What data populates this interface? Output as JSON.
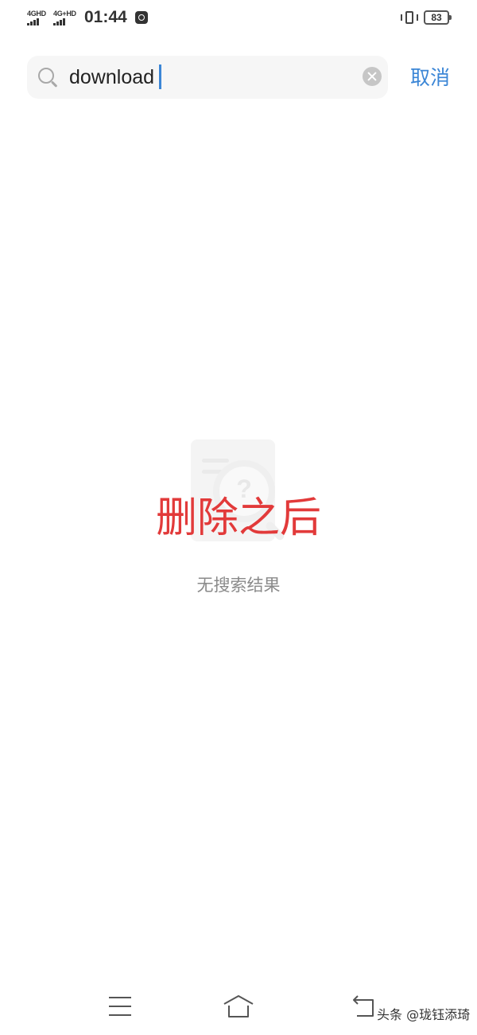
{
  "status_bar": {
    "network_1": "4GHD",
    "network_2": "4G+HD",
    "time": "01:44",
    "battery_level": "83"
  },
  "search": {
    "value": "download",
    "placeholder": "",
    "cancel_label": "取消"
  },
  "annotation": {
    "caption": "删除之后",
    "color": "#e23a3a"
  },
  "empty_state": {
    "message": "无搜索结果",
    "icon": "no-results-illustration"
  },
  "nav_bar": {
    "icons": [
      "menu-icon",
      "home-icon",
      "back-icon"
    ]
  },
  "watermark": "头条 @珑钰添琦",
  "colors": {
    "accent": "#3b86d6",
    "background": "#ffffff"
  }
}
